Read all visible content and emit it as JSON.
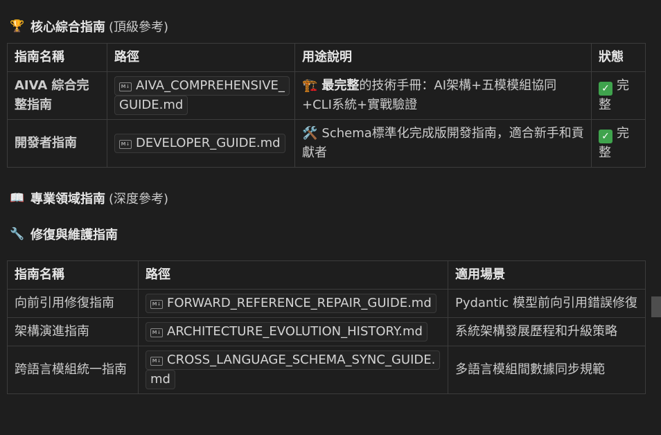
{
  "sections": {
    "core": {
      "emoji": "🏆",
      "title": "核心綜合指南",
      "subtitle": "(頂級參考)"
    },
    "domain": {
      "emoji": "📖",
      "title": "專業領域指南",
      "subtitle": "(深度參考)"
    },
    "repair": {
      "emoji": "🔧",
      "title": "修復與維護指南"
    }
  },
  "table1": {
    "headers": [
      "指南名稱",
      "路徑",
      "用途說明",
      "狀態"
    ],
    "rows": [
      {
        "name": "AIVA 綜合完整指南",
        "path": "AIVA_COMPREHENSIVE_GUIDE.md",
        "desc_emoji": "🏗️",
        "desc_bold": "最完整",
        "desc_rest": "的技術手冊：AI架構+五模模組協同+CLI系統+實戰驗證",
        "status": "完整"
      },
      {
        "name": "開發者指南",
        "path": "DEVELOPER_GUIDE.md",
        "desc_emoji": "🛠️",
        "desc_rest": "Schema標準化完成版開發指南，適合新手和貢獻者",
        "status": "完整"
      }
    ]
  },
  "table2": {
    "headers": [
      "指南名稱",
      "路徑",
      "適用場景"
    ],
    "rows": [
      {
        "name": "向前引用修復指南",
        "path": "FORWARD_REFERENCE_REPAIR_GUIDE.md",
        "scene": "Pydantic 模型前向引用錯誤修復"
      },
      {
        "name": "架構演進指南",
        "path": "ARCHITECTURE_EVOLUTION_HISTORY.md",
        "scene": "系統架構發展歷程和升級策略"
      },
      {
        "name": "跨語言模組統一指南",
        "path": "CROSS_LANGUAGE_SCHEMA_SYNC_GUIDE.md",
        "scene": "多語言模組間數據同步規範"
      }
    ]
  },
  "icons": {
    "markdown_file": "markdown-file-icon",
    "status_complete": "check-mark-button-icon"
  },
  "md_icon_label": "M↓",
  "check_glyph": "✓",
  "colors": {
    "background": "#1e1e1e",
    "border": "#3c3c3c",
    "text": "#cccccc",
    "check_green": "#3fa34d"
  }
}
